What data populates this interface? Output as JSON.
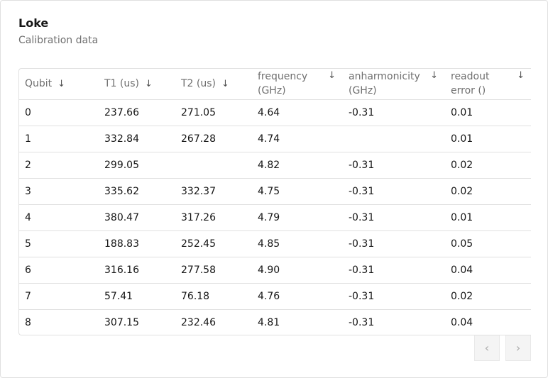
{
  "card": {
    "title": "Loke",
    "subtitle": "Calibration data"
  },
  "table": {
    "columns": [
      {
        "label": "Qubit",
        "sort_icon": "arrow-down-icon"
      },
      {
        "label": "T1 (us)",
        "sort_icon": "arrow-down-icon"
      },
      {
        "label": "T2 (us)",
        "sort_icon": "arrow-down-icon"
      },
      {
        "label": "frequency (GHz)",
        "sort_icon": "arrow-down-icon"
      },
      {
        "label": "anharmonicity (GHz)",
        "sort_icon": "arrow-down-icon"
      },
      {
        "label": "readout error ()",
        "sort_icon": "arrow-down-icon"
      }
    ],
    "rows": [
      [
        "0",
        "237.66",
        "271.05",
        "4.64",
        "-0.31",
        "0.01"
      ],
      [
        "1",
        "332.84",
        "267.28",
        "4.74",
        "",
        "0.01"
      ],
      [
        "2",
        "299.05",
        "",
        "4.82",
        "-0.31",
        "0.02"
      ],
      [
        "3",
        "335.62",
        "332.37",
        "4.75",
        "-0.31",
        "0.02"
      ],
      [
        "4",
        "380.47",
        "317.26",
        "4.79",
        "-0.31",
        "0.01"
      ],
      [
        "5",
        "188.83",
        "252.45",
        "4.85",
        "-0.31",
        "0.05"
      ],
      [
        "6",
        "316.16",
        "277.58",
        "4.90",
        "-0.31",
        "0.04"
      ],
      [
        "7",
        "57.41",
        "76.18",
        "4.76",
        "-0.31",
        "0.02"
      ],
      [
        "8",
        "307.15",
        "232.46",
        "4.81",
        "-0.31",
        "0.04"
      ]
    ]
  },
  "pagination": {
    "prev_icon": "chevron-left-icon",
    "next_icon": "chevron-right-icon",
    "prev_glyph": "‹",
    "next_glyph": "›",
    "sort_glyph": "↓"
  }
}
